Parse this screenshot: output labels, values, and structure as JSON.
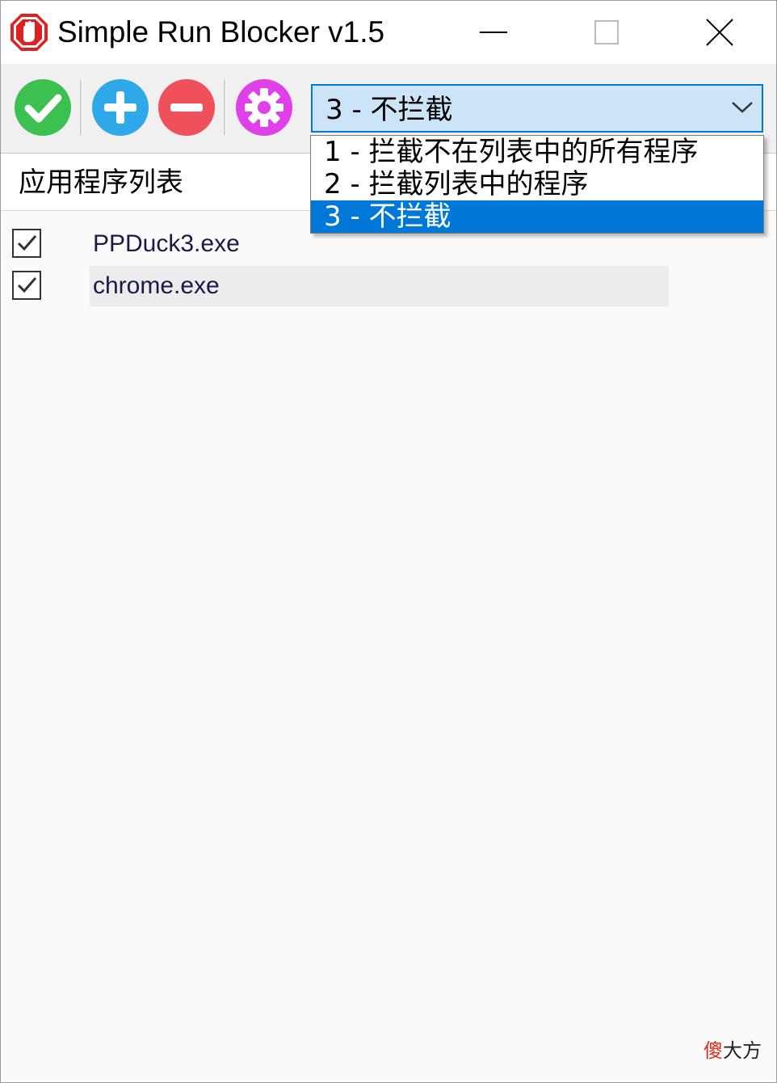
{
  "window": {
    "title": "Simple Run Blocker v1.5",
    "controls": {
      "minimize": "minimize",
      "maximize": "maximize",
      "close": "close"
    }
  },
  "toolbar": {
    "buttons": [
      {
        "name": "enable-button",
        "icon": "check-icon",
        "color": "#3cc050"
      },
      {
        "name": "add-button",
        "icon": "plus-icon",
        "color": "#2ea8e8"
      },
      {
        "name": "remove-button",
        "icon": "minus-icon",
        "color": "#f0505a"
      },
      {
        "name": "settings-button",
        "icon": "gear-icon",
        "color": "#e040e8"
      }
    ],
    "mode_select": {
      "selected": "3 - 不拦截",
      "options": [
        "1 - 拦截不在列表中的所有程序",
        "2 - 拦截列表中的程序",
        "3 - 不拦截"
      ],
      "selected_index": 2,
      "accent": "#0078d7"
    }
  },
  "app_list": {
    "header": "应用程序列表",
    "items": [
      {
        "name": "PPDuck3.exe",
        "checked": true
      },
      {
        "name": "chrome.exe",
        "checked": true
      }
    ]
  },
  "watermark": {
    "red": "傻",
    "rest": "大方"
  }
}
